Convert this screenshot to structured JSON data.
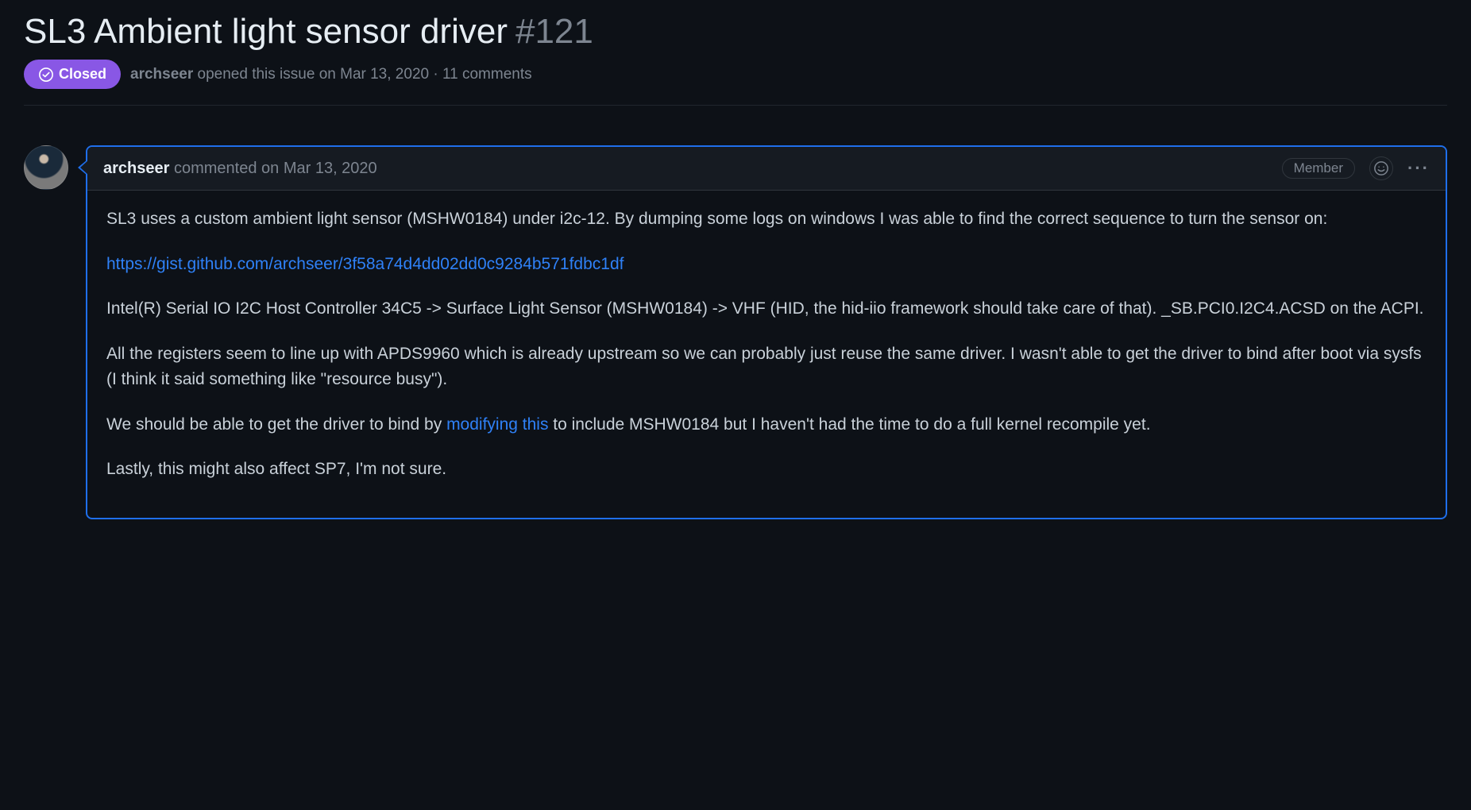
{
  "issue": {
    "title": "SL3 Ambient light sensor driver",
    "number": "#121",
    "status_label": "Closed",
    "meta_author": "archseer",
    "meta_action": " opened this issue ",
    "meta_date": "on Mar 13, 2020",
    "meta_sep": " · ",
    "meta_comments": "11 comments"
  },
  "comment": {
    "author": "archseer",
    "verb": " commented ",
    "timestamp": "on Mar 13, 2020",
    "badge": "Member",
    "body": {
      "p1": "SL3 uses a custom ambient light sensor (MSHW0184) under i2c-12. By dumping some logs on windows I was able to find the correct sequence to turn the sensor on:",
      "link1": "https://gist.github.com/archseer/3f58a74d4dd02dd0c9284b571fdbc1df",
      "p2": "Intel(R) Serial IO I2C Host Controller 34C5 -> Surface Light Sensor (MSHW0184) -> VHF (HID, the hid-iio framework should take care of that). _SB.PCI0.I2C4.ACSD on the ACPI.",
      "p3": "All the registers seem to line up with APDS9960 which is already upstream so we can probably just reuse the same driver. I wasn't able to get the driver to bind after boot via sysfs (I think it said something like \"resource busy\").",
      "p4a": "We should be able to get the driver to bind by ",
      "p4link": "modifying this",
      "p4b": " to include MSHW0184 but I haven't had the time to do a full kernel recompile yet.",
      "p5": "Lastly, this might also affect SP7, I'm not sure."
    }
  }
}
